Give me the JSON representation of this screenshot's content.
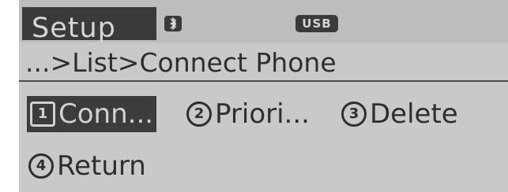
{
  "header": {
    "title": "Setup",
    "bluetooth_icon": "bluetooth-icon",
    "usb_label": "USB"
  },
  "breadcrumb": {
    "text": "...>List>Connect Phone"
  },
  "menu": {
    "items": [
      {
        "number": "1",
        "label": "Conn...",
        "selected": true
      },
      {
        "number": "2",
        "label": "Priori...",
        "selected": false
      },
      {
        "number": "3",
        "label": "Delete",
        "selected": false
      },
      {
        "number": "4",
        "label": "Return",
        "selected": false
      }
    ]
  },
  "colors": {
    "screen_bg": "#c9c9c9",
    "highlight_bg": "#3a3a3a",
    "text_dark": "#2e2e2e",
    "text_light": "#d6d6d6"
  }
}
